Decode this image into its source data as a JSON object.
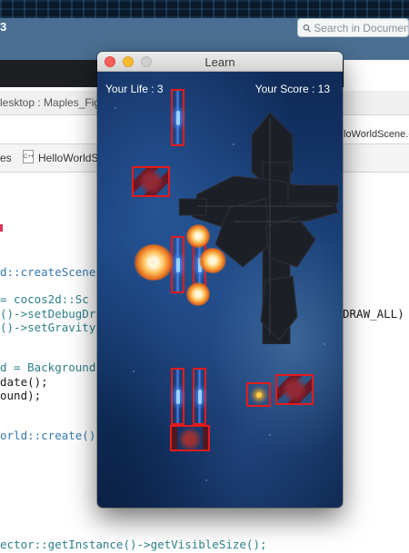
{
  "ide": {
    "toolbar_title": "3",
    "search_placeholder": "Search in Documentation",
    "crumb_path": "lesktop : Maples_Fig",
    "crumb_right": "loWorldScene.c",
    "crumb2_left": "es",
    "crumb2_file": "HelloWorldS",
    "file_icon_text": "C++",
    "code_lines": [
      "d::createScene",
      "= cocos2d::Sc",
      "()->setDebugDr",
      "()->setGravity",
      "d = Background",
      "date();",
      "ound);",
      "orld::create()",
      "ector::getInstance()->getVisibleSize();"
    ],
    "code_right": "DRAW_ALL)"
  },
  "window": {
    "title": "Learn"
  },
  "game": {
    "life_label": "Your Life : 3",
    "score_label": "Your Score : 13"
  },
  "colors": {
    "hitbox": "#e51a1a",
    "toolbar": "#4b6f92",
    "close": "#fc5f57",
    "minimize": "#fdbc2e",
    "zoom": "#cfcfcf"
  }
}
